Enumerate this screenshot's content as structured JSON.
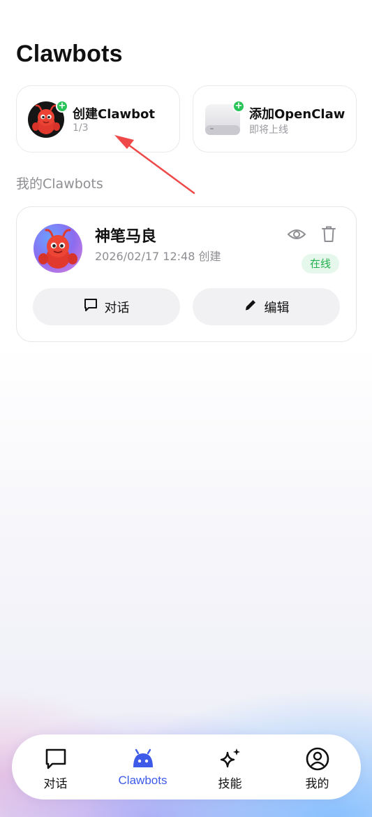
{
  "header": {
    "title": "Clawbots"
  },
  "actions": [
    {
      "title": "创建Clawbot",
      "subtitle": "1/3",
      "thumb": "red-lobster-avatar-icon",
      "badge": "plus-icon"
    },
    {
      "title": "添加OpenClaw",
      "subtitle": "即将上线",
      "thumb": "mini-pc-device-icon",
      "badge": "plus-icon"
    }
  ],
  "section": {
    "label": "我的Clawbots"
  },
  "bots": [
    {
      "name": "神笔马良",
      "created": "2026/02/17 12:48 创建",
      "status": "在线",
      "chat_label": "对话",
      "edit_label": "编辑",
      "icons": [
        "eye-icon",
        "trash-icon",
        "chat-bubble-icon",
        "pencil-icon"
      ]
    }
  ],
  "nav": {
    "items": [
      {
        "label": "对话",
        "icon": "chat-bubble-icon",
        "active": false
      },
      {
        "label": "Clawbots",
        "icon": "robot-icon",
        "active": true
      },
      {
        "label": "技能",
        "icon": "sparkle-icon",
        "active": false
      },
      {
        "label": "我的",
        "icon": "user-circle-icon",
        "active": false
      }
    ]
  },
  "colors": {
    "accent": "#3d5ae8",
    "online_bg": "#e6f8ec",
    "online_text": "#22b04e",
    "plus_badge": "#2bc45a",
    "annotation_arrow": "#ee4848"
  }
}
